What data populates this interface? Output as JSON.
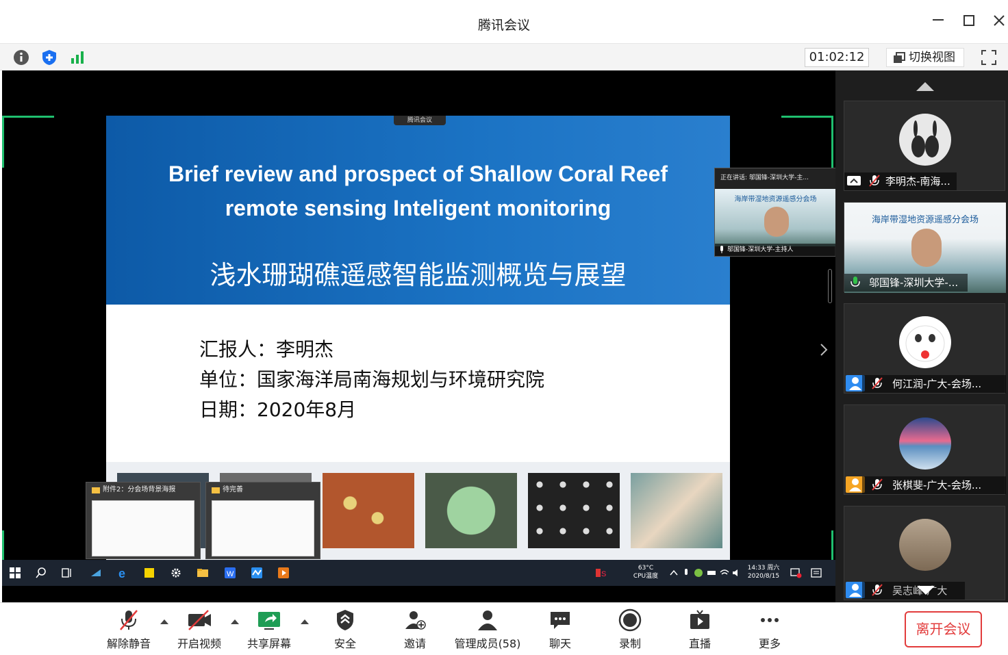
{
  "window": {
    "title": "腾讯会议"
  },
  "toolbar": {
    "timer": "01:02:12",
    "switch_view": "切换视图"
  },
  "slide": {
    "meeting_tag": "腾讯会议",
    "title_en_line1": "Brief review and prospect of Shallow Coral Reef",
    "title_en_line2": "remote sensing Inteligent monitoring",
    "title_cn": "浅水珊瑚礁遥感智能监测概览与展望",
    "reporter": "汇报人：李明杰",
    "unit": "单位：国家海洋局南海规划与环境研究院",
    "date": "日期：2020年8月"
  },
  "speaker_overlay": {
    "top_text": "正在讲话: 邬国锋-深圳大学-主...",
    "banner": "海岸带湿地资源遥感分会场",
    "name": "邬国锋-深圳大学-主持人"
  },
  "thumbnails": [
    {
      "title": "附件2：分会场背景海报"
    },
    {
      "title": "待完善"
    }
  ],
  "taskbar": {
    "temp": "63°C",
    "temp_label": "CPU温度",
    "time": "14:33 周六",
    "date": "2020/8/15"
  },
  "participants": [
    {
      "name": "李明杰-南海..."
    },
    {
      "name": "邬国锋-深圳大学-...",
      "banner": "海岸带湿地资源遥感分会场"
    },
    {
      "name": "何江润-广大-会场..."
    },
    {
      "name": "张棋斐-广大-会场..."
    },
    {
      "name": "吴志峰-广大"
    }
  ],
  "bottom": {
    "unmute": "解除静音",
    "video": "开启视频",
    "share": "共享屏幕",
    "security": "安全",
    "invite": "邀请",
    "members": "管理成员(58)",
    "chat": "聊天",
    "record": "录制",
    "live": "直播",
    "more": "更多",
    "leave": "离开会议"
  },
  "colors": {
    "accent_green": "#1fc06f",
    "leave_red": "#e23b3b",
    "slide_blue": "#0d5aa7"
  }
}
